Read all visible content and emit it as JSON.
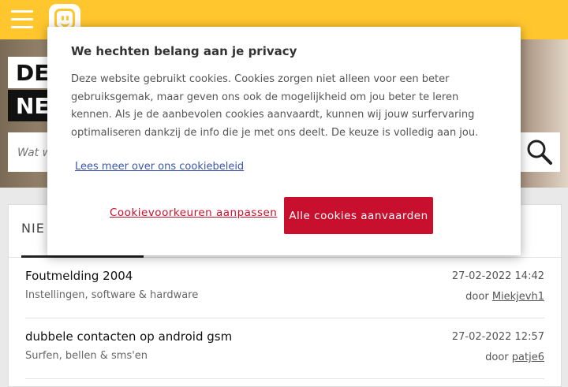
{
  "header": {
    "menu_icon": "hamburger-menu-icon",
    "logo_icon": "telenet-smiley-logo-icon",
    "brand_color": "#ffc62e"
  },
  "hero": {
    "title_line1": "DE",
    "title_line2": "NE",
    "search_placeholder": "Wat w",
    "search_icon": "search-icon"
  },
  "tabs": {
    "active_label": "NIE"
  },
  "topics": [
    {
      "title": "Foutmelding 2004",
      "category": "Instellingen, software & hardware",
      "date": "27-02-2022 14:42",
      "by_prefix": "door",
      "author": "Miekjevh1"
    },
    {
      "title": "dubbele contacten op android gsm",
      "category": "Surfen, bellen & sms'en",
      "date": "27-02-2022 12:57",
      "by_prefix": "door",
      "author": "patje6"
    }
  ],
  "cookie_modal": {
    "title": "We hechten belang aan je privacy",
    "body": "Deze website gebruikt cookies. Cookies zorgen niet alleen voor een beter gebruiksgemak, maar geven ons ook de mogelijkheid om jou beter te leren kennen. Als je de aanbevolen cookies aanvaardt, kunnen wij jouw surfervaring optimaliseren dankzij de info die je met ons deelt. De keuze is volledig aan jou.",
    "policy_link": "Lees meer over ons cookiebeleid",
    "preferences_button": "Cookievoorkeuren aanpassen",
    "accept_button": "Alle cookies aanvaarden",
    "accent_color": "#c8102e"
  }
}
